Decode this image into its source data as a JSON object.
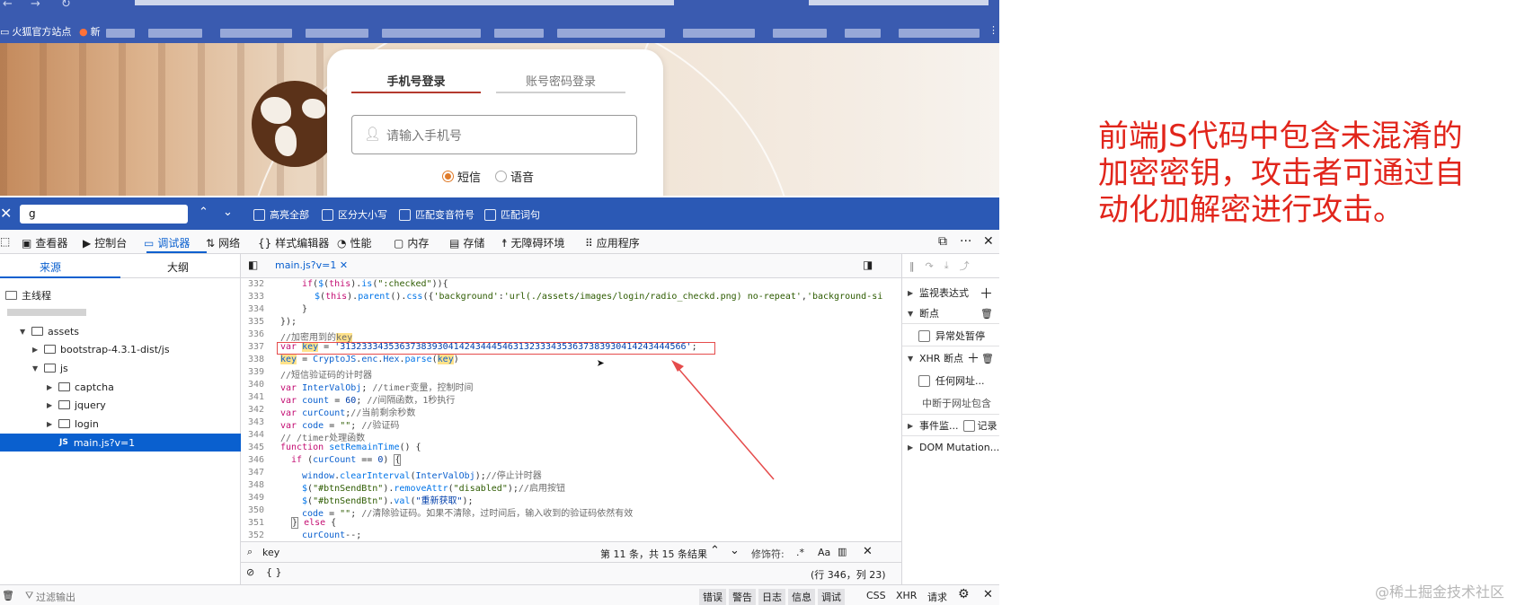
{
  "browser": {
    "bookmarks": [
      {
        "label": "火狐官方站点"
      },
      {
        "label": "新"
      }
    ]
  },
  "login": {
    "tab_phone": "手机号登录",
    "tab_account": "账号密码登录",
    "phone_placeholder": "请输入手机号",
    "radio_sms": "短信",
    "radio_voice": "语音"
  },
  "findbar": {
    "query": "g",
    "options": [
      "高亮全部",
      "区分大小写",
      "匹配变音符号",
      "匹配词句"
    ]
  },
  "devtools": {
    "tabs": [
      "查看器",
      "控制台",
      "调试器",
      "网络",
      "样式编辑器",
      "性能",
      "内存",
      "存储",
      "无障碍环境",
      "应用程序"
    ],
    "active_tab": "调试器",
    "left_tabs": {
      "sources": "来源",
      "outline": "大纲"
    },
    "tree": [
      {
        "label": "主线程",
        "depth": 0
      },
      {
        "label": "assets",
        "depth": 1
      },
      {
        "label": "bootstrap-4.3.1-dist/js",
        "depth": 2
      },
      {
        "label": "js",
        "depth": 2
      },
      {
        "label": "captcha",
        "depth": 3
      },
      {
        "label": "jquery",
        "depth": 3
      },
      {
        "label": "login",
        "depth": 3
      },
      {
        "label": "main.js?v=1",
        "depth": 3,
        "selected": true
      }
    ],
    "file_tab": "main.js?v=1",
    "line_numbers": [
      "332",
      "333",
      "334",
      "335",
      "336",
      "337",
      "338",
      "339",
      "340",
      "341",
      "342",
      "343",
      "344",
      "345",
      "346",
      "347",
      "348",
      "349",
      "350",
      "351",
      "352"
    ],
    "search": {
      "query": "key",
      "result": "第 11 条，共 15 条结果",
      "modifier_label": "修饰符:"
    },
    "cursor_pos": "(行 346，列 23)",
    "right_pane": {
      "watch": "监视表达式",
      "breakpoints": "断点",
      "pause_exceptions": "异常处暂停",
      "xhr": "XHR 断点",
      "any_url": "任何网址...",
      "url_contains": "中断于网址包含",
      "events": "事件监...",
      "record": "记录",
      "dom_mutation": "DOM Mutation..."
    },
    "console": {
      "filter_placeholder": "过滤输出",
      "levels": [
        "错误",
        "警告",
        "日志",
        "信息",
        "调试"
      ],
      "types": [
        "CSS",
        "XHR",
        "请求"
      ]
    }
  },
  "annotation": {
    "lines": [
      "前端JS代码中包含未混淆的",
      "加密密钥，攻击者可通过自",
      "动化加解密进行攻击。"
    ]
  },
  "watermark": "@稀土掘金技术社区",
  "colors": {
    "note": "#e1251b",
    "chrome": "#3a5bb0",
    "findbar": "#2b59b5",
    "accent": "#0a60cf"
  }
}
